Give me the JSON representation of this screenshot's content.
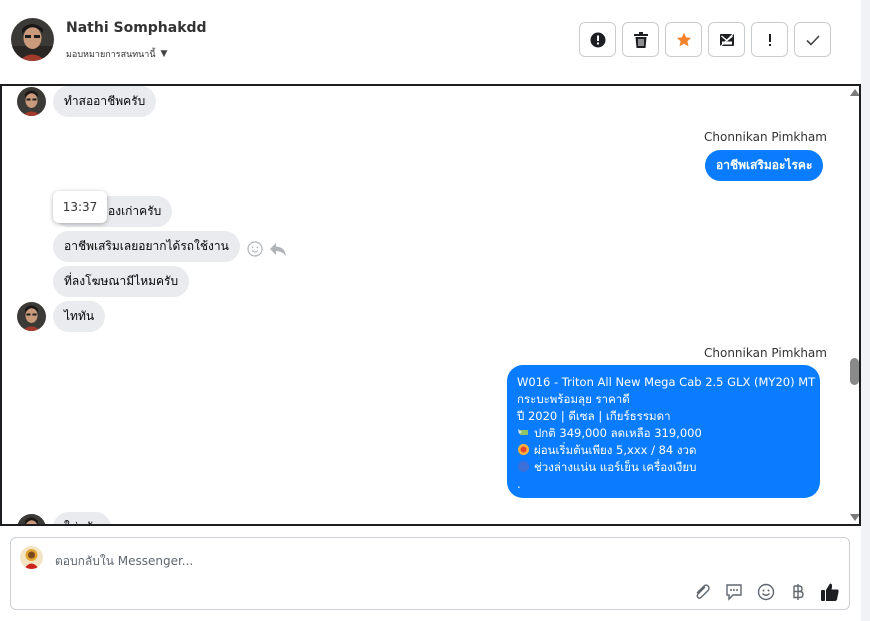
{
  "header": {
    "name": "Nathi Somphakdd",
    "assign_label": "มอบหมายการสนทนานี้",
    "actions": [
      {
        "icon": "alert-circle-icon"
      },
      {
        "icon": "trash-icon"
      },
      {
        "icon": "star-icon"
      },
      {
        "icon": "mail-off-icon"
      },
      {
        "icon": "exclamation-icon"
      },
      {
        "icon": "check-icon"
      }
    ]
  },
  "colors": {
    "accent": "#0a7cff",
    "star": "#f5832a",
    "incoming_bubble": "#e9ebee"
  },
  "chat": {
    "messages": [
      {
        "text": "ทำสออาชีพครับ"
      },
      {
        "sender": "Chonnikan Pimkham",
        "text": "อาชีพเสริมอะไรคะ"
      },
      {
        "text": "องเก่าครับ"
      },
      {
        "text": "อาชีพเสริมเลยอยากได้รถใช้งาน"
      },
      {
        "text": "ที่ลงโฆษณามีไหมครับ"
      },
      {
        "text": "ไททัน"
      },
      {
        "text": "ใช่ครับ"
      }
    ],
    "timestamp_tooltip": "13:37",
    "listing": {
      "sender": "Chonnikan Pimkham",
      "title": "W016 - Triton All New Mega Cab 2.5 GLX (MY20) MT",
      "line2": "กระบะพร้อมลุย ราคาดี",
      "line3": "ปี 2020 | ดีเซล | เกียร์ธรรมดา",
      "line4": "ปกติ 349,000 ลดเหลือ 319,000",
      "line5": "ผ่อนเริ่มต้นเพียง 5,xxx / 84 งวด",
      "line6": "ช่วงล่างแน่น แอร์เย็น เครื่องเงียบ",
      "line7": "."
    }
  },
  "composer": {
    "placeholder": "ตอบกลับใน Messenger...",
    "tools": [
      "paperclip-icon",
      "chat-bubble-icon",
      "smiley-icon",
      "baht-icon",
      "thumbs-up-icon"
    ]
  }
}
